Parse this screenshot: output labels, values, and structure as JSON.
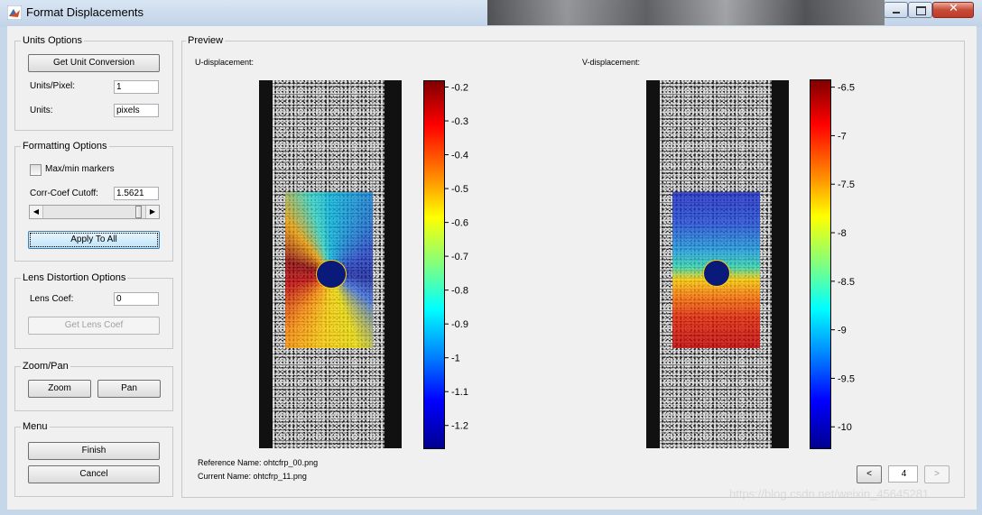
{
  "window": {
    "title": "Format Displacements"
  },
  "units_options": {
    "title": "Units Options",
    "get_unit_conversion": "Get Unit Conversion",
    "units_per_pixel_label": "Units/Pixel:",
    "units_per_pixel_value": "1",
    "units_label": "Units:",
    "units_value": "pixels"
  },
  "formatting_options": {
    "title": "Formatting Options",
    "max_min_markers_label": "Max/min markers",
    "max_min_markers_checked": false,
    "corr_coef_label": "Corr-Coef Cutoff:",
    "corr_coef_value": "1.5621",
    "slider_level": 0.95,
    "apply_to_all": "Apply To All"
  },
  "lens_distortion": {
    "title": "Lens Distortion Options",
    "lens_coef_label": "Lens Coef:",
    "lens_coef_value": "0",
    "get_lens_coef": "Get Lens Coef"
  },
  "zoom_pan": {
    "title": "Zoom/Pan",
    "zoom": "Zoom",
    "pan": "Pan"
  },
  "menu": {
    "title": "Menu",
    "finish": "Finish",
    "cancel": "Cancel"
  },
  "preview": {
    "title": "Preview",
    "u_label": "U-displacement:",
    "v_label": "V-displacement:",
    "reference_name": "Reference Name: ohtcfrp_00.png",
    "current_name": "Current Name: ohtcfrp_11.png",
    "prev": "<",
    "frame": "4",
    "next": ">",
    "u_colorbar": {
      "ticks": [
        "-0.2",
        "-0.3",
        "-0.4",
        "-0.5",
        "-0.6",
        "-0.7",
        "-0.8",
        "-0.9",
        "-1",
        "-1.1",
        "-1.2"
      ],
      "max": -0.18,
      "min": -1.27
    },
    "v_colorbar": {
      "ticks": [
        "-6.5",
        "-7",
        "-7.5",
        "-8",
        "-8.5",
        "-9",
        "-9.5",
        "-10"
      ],
      "max": -6.42,
      "min": -10.23
    },
    "colormap": "jet"
  },
  "watermark": "https://blog.csdn.net/weixin_45645281"
}
